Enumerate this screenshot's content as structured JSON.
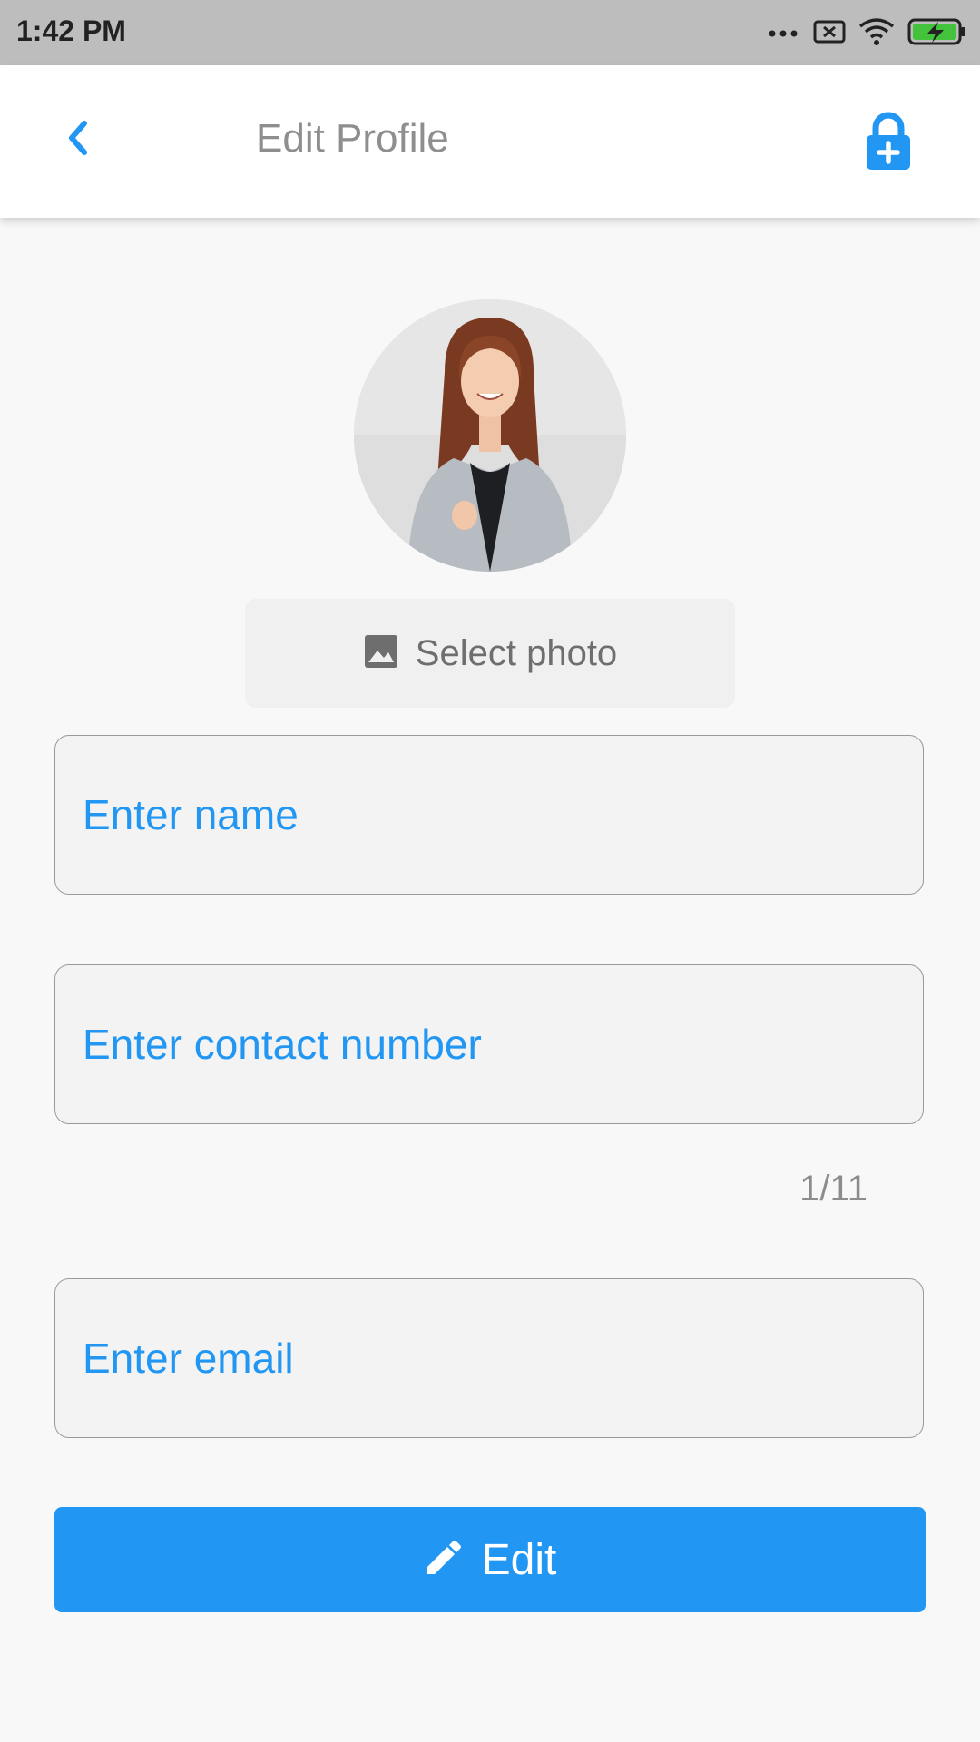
{
  "status_bar": {
    "time": "1:42 PM",
    "icons": [
      "more-dots-icon",
      "sim-x-icon",
      "wifi-icon",
      "battery-charging-icon"
    ]
  },
  "app_bar": {
    "title": "Edit Profile",
    "back_icon": "chevron-left-icon",
    "action_icon": "lock-plus-icon"
  },
  "profile": {
    "avatar_icon": "profile-photo",
    "select_photo_label": "Select photo",
    "select_photo_icon": "image-icon"
  },
  "form": {
    "name_placeholder": "Enter name",
    "name_value": "",
    "contact_placeholder": "Enter contact number",
    "contact_value": "",
    "contact_counter": "1/11",
    "email_placeholder": "Enter email",
    "email_value": ""
  },
  "edit_button": {
    "label": "Edit",
    "icon": "pencil-icon"
  },
  "colors": {
    "accent": "#2196F3",
    "status_bar_bg": "#BDBDBD",
    "background": "#F8F8F8",
    "field_bg": "#F3F3F3",
    "battery_green": "#43C23B"
  }
}
